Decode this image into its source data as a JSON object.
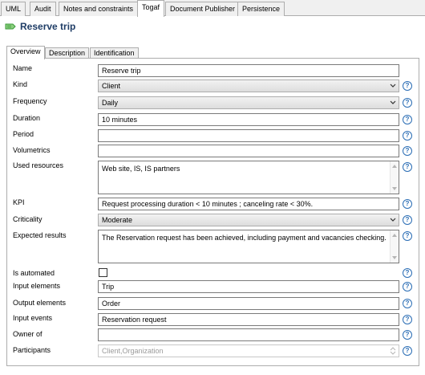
{
  "top_tabs": [
    {
      "label": "UML"
    },
    {
      "label": "Audit"
    },
    {
      "label": "Notes and constraints"
    },
    {
      "label": "Togaf"
    },
    {
      "label": "Document Publisher"
    },
    {
      "label": "Persistence"
    }
  ],
  "title": "Reserve trip",
  "title_icon": "process-icon",
  "inner_tabs": [
    {
      "label": "Overview"
    },
    {
      "label": "Description"
    },
    {
      "label": "Identification"
    }
  ],
  "fields": {
    "name": {
      "label": "Name",
      "value": "Reserve trip"
    },
    "kind": {
      "label": "Kind",
      "value": "Client"
    },
    "frequency": {
      "label": "Frequency",
      "value": "Daily"
    },
    "duration": {
      "label": "Duration",
      "value": "10 minutes"
    },
    "period": {
      "label": "Period",
      "value": ""
    },
    "volumetrics": {
      "label": "Volumetrics",
      "value": ""
    },
    "used_resources": {
      "label": "Used resources",
      "value": "Web site, IS, IS partners"
    },
    "kpi": {
      "label": "KPI",
      "value": "Request processing duration < 10 minutes ; canceling rate < 30%."
    },
    "criticality": {
      "label": "Criticality",
      "value": "Moderate"
    },
    "expected_results": {
      "label": "Expected results",
      "value": "The Reservation request has been achieved, including payment and vacancies checking."
    },
    "is_automated": {
      "label": "Is automated",
      "checked": false
    },
    "input_elements": {
      "label": "Input elements",
      "value": "Trip"
    },
    "output_elements": {
      "label": "Output elements",
      "value": "Order"
    },
    "input_events": {
      "label": "Input events",
      "value": "Reservation request"
    },
    "owner_of": {
      "label": "Owner of",
      "value": ""
    },
    "participants": {
      "label": "Participants",
      "value": "Client,Organization"
    }
  },
  "help_glyph": "?",
  "colors": {
    "accent": "#2a6db5",
    "title": "#1f3d66",
    "icon": "#3a9a3a"
  }
}
